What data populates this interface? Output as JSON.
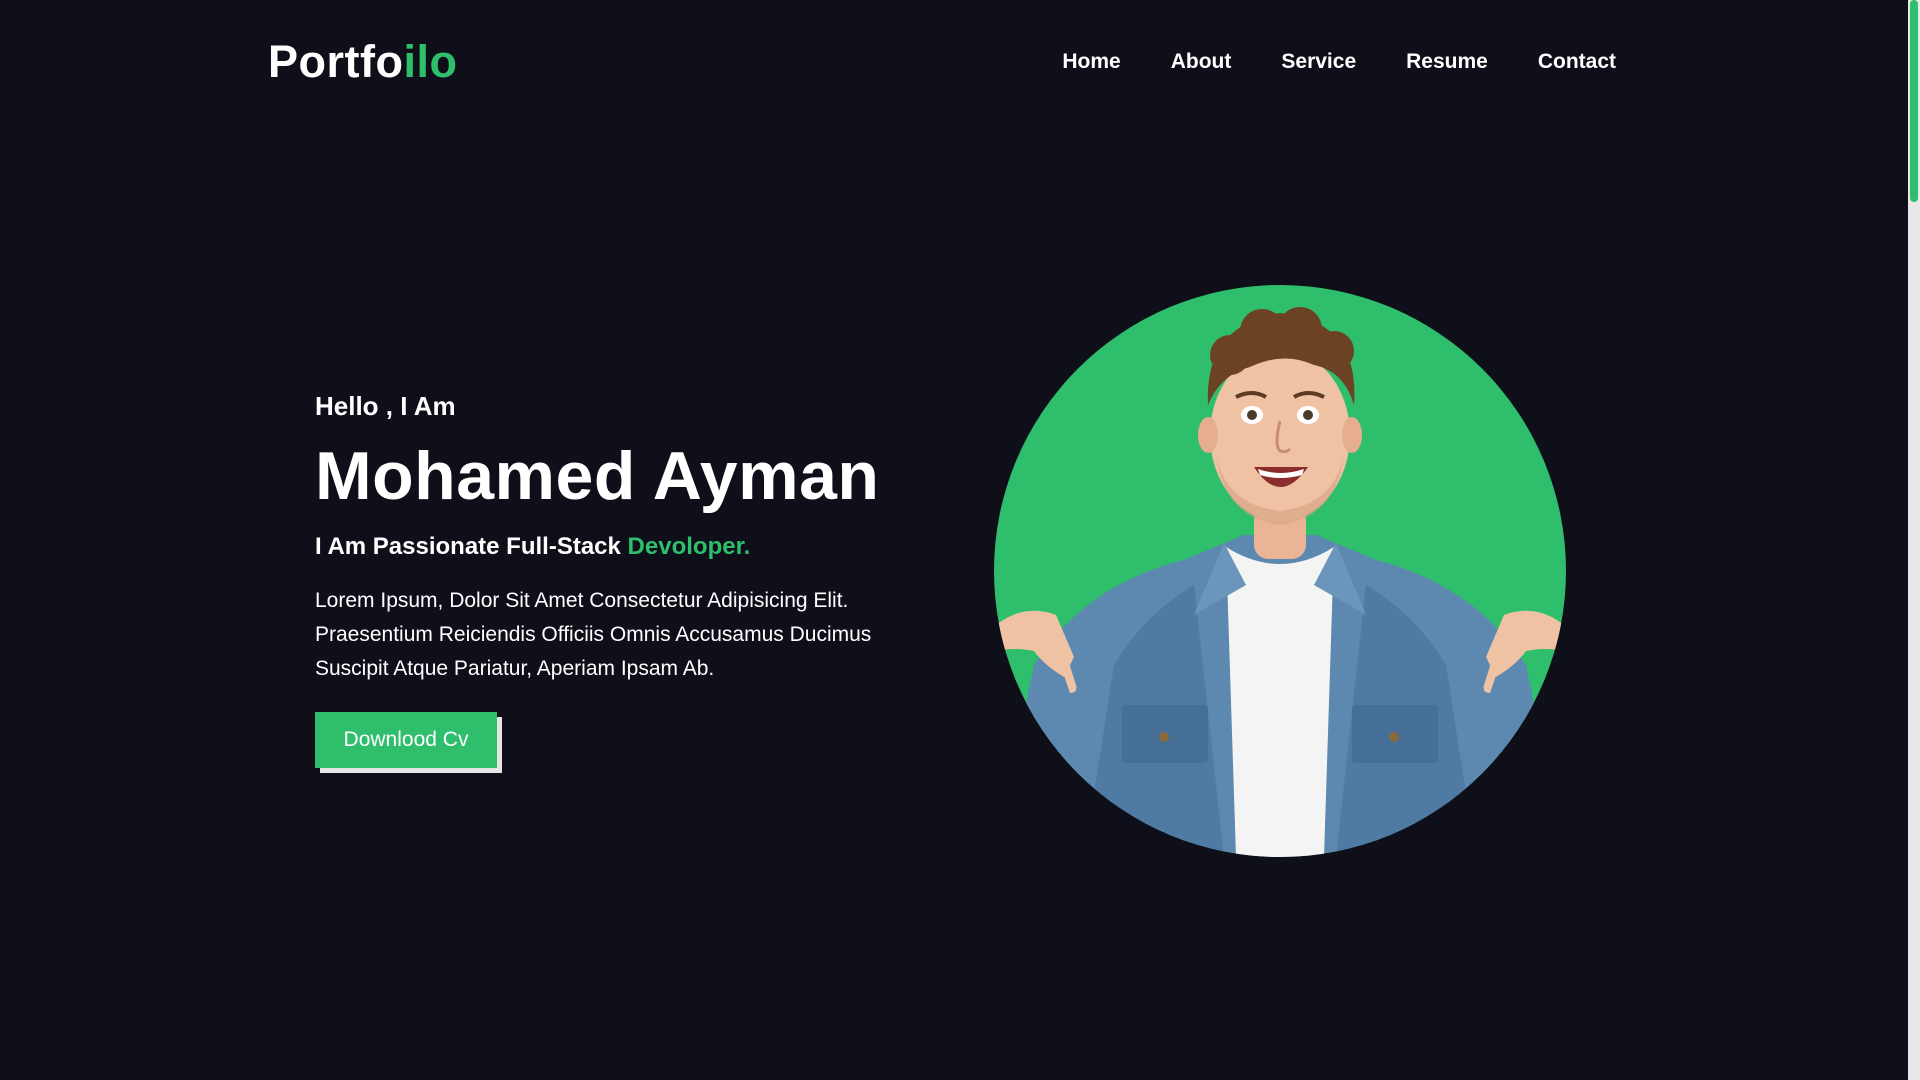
{
  "header": {
    "logo_main": "Portfo",
    "logo_accent": "ilo",
    "nav": [
      "Home",
      "About",
      "Service",
      "Resume",
      "Contact"
    ]
  },
  "hero": {
    "greeting": "Hello , I Am",
    "name": "Mohamed Ayman",
    "tagline_main": "I Am Passionate Full-Stack ",
    "tagline_accent": "Devoloper.",
    "description": "Lorem Ipsum, Dolor Sit Amet Consectetur Adipisicing Elit. Praesentium Reiciendis Officiis Omnis Accusamus Ducimus Suscipit Atque Pariatur, Aperiam Ipsam Ab.",
    "button_label": "Downlood Cv"
  },
  "colors": {
    "background": "#0f0f1a",
    "accent": "#2fbe6b",
    "text": "#ffffff"
  },
  "icons": {
    "portrait": "person-portrait"
  }
}
